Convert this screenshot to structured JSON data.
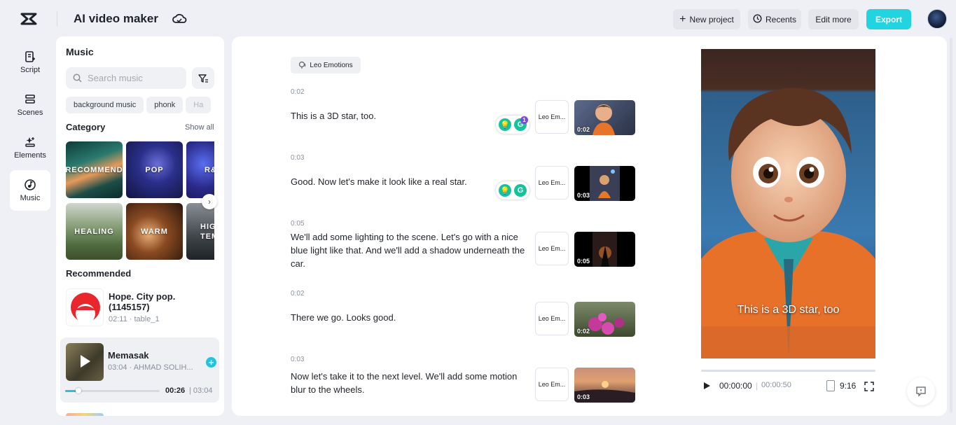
{
  "header": {
    "title": "AI video maker",
    "new_project": "New project",
    "recents": "Recents",
    "edit_more": "Edit more",
    "export": "Export",
    "accent": "#22d3e0"
  },
  "nav": [
    {
      "label": "Script",
      "icon": "script-icon"
    },
    {
      "label": "Scenes",
      "icon": "scenes-icon"
    },
    {
      "label": "Elements",
      "icon": "elements-icon"
    },
    {
      "label": "Music",
      "icon": "music-icon",
      "active": true
    }
  ],
  "music": {
    "title": "Music",
    "search_placeholder": "Search music",
    "chips": [
      "background music",
      "phonk",
      "Ha"
    ],
    "category_label": "Category",
    "show_all": "Show all",
    "categories": [
      "RECOMMEND",
      "POP",
      "R&",
      "HEALING",
      "WARM",
      "HIGH TEM"
    ],
    "recommended_label": "Recommended",
    "recommended": [
      {
        "title": "Hope. City pop. (1145157)",
        "meta": "02:11 · table_1"
      },
      {
        "title": "Memasak",
        "meta": "03:04 · AHMAD SOLIH..."
      }
    ],
    "player": {
      "current": "00:26",
      "total": "03:04",
      "progress": 0.14
    }
  },
  "script": {
    "voice": "Leo Emotions",
    "scenes": [
      {
        "time": "0:02",
        "text": "This is a 3D star, too.",
        "voice": "Leo Em...",
        "clip_dur": "0:02"
      },
      {
        "time": "0:03",
        "text": "Good. Now let's make it look like a real star.",
        "voice": "Leo Em...",
        "clip_dur": "0:03"
      },
      {
        "time": "0:05",
        "text": "We'll add some lighting to the scene. Let's go with a nice blue light like that. And we'll add a shadow underneath the car.",
        "voice": "Leo Em...",
        "clip_dur": "0:05"
      },
      {
        "time": "0:02",
        "text": "There we go. Looks good.",
        "voice": "Leo Em...",
        "clip_dur": "0:02"
      },
      {
        "time": "0:03",
        "text": "Now let's take it to the next level. We'll add some motion blur to the wheels.",
        "voice": "Leo Em...",
        "clip_dur": "0:03"
      }
    ],
    "grammarly_badge": "1"
  },
  "preview": {
    "caption": "This is a 3D star, too",
    "current_time": "00:00:00",
    "total_time": "00:00:50",
    "ratio": "9:16"
  }
}
